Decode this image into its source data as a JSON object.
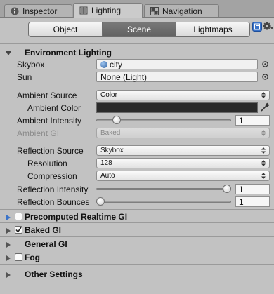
{
  "tabs": [
    {
      "label": "Inspector",
      "icon": "info-icon",
      "active": false
    },
    {
      "label": "Lighting",
      "icon": "lighting-icon",
      "active": true
    },
    {
      "label": "Navigation",
      "icon": "navigation-icon",
      "active": false
    }
  ],
  "toolbar": {
    "object_label": "Object",
    "scene_label": "Scene",
    "lightmaps_label": "Lightmaps",
    "active": "Scene"
  },
  "environment": {
    "title": "Environment Lighting",
    "skybox_label": "Skybox",
    "skybox_value": "city",
    "sun_label": "Sun",
    "sun_value": "None (Light)",
    "ambient_source_label": "Ambient Source",
    "ambient_source_value": "Color",
    "ambient_color_label": "Ambient Color",
    "ambient_color_value": "#2a2a2a",
    "ambient_intensity_label": "Ambient Intensity",
    "ambient_intensity_value": "1",
    "ambient_intensity_fraction": 0.125,
    "ambient_gi_label": "Ambient GI",
    "ambient_gi_value": "Baked",
    "reflection_source_label": "Reflection Source",
    "reflection_source_value": "Skybox",
    "resolution_label": "Resolution",
    "resolution_value": "128",
    "compression_label": "Compression",
    "compression_value": "Auto",
    "reflection_intensity_label": "Reflection Intensity",
    "reflection_intensity_value": "1",
    "reflection_intensity_fraction": 1.0,
    "reflection_bounces_label": "Reflection Bounces",
    "reflection_bounces_value": "1",
    "reflection_bounces_fraction": 0.0
  },
  "sections": {
    "precomputed": "Precomputed Realtime GI",
    "baked": "Baked GI",
    "general": "General GI",
    "fog": "Fog",
    "other": "Other Settings"
  },
  "colors": {
    "accent_blue": "#3a73c9",
    "active_segment": "#6d6d6d",
    "panel_bg": "#c2c2c2"
  }
}
